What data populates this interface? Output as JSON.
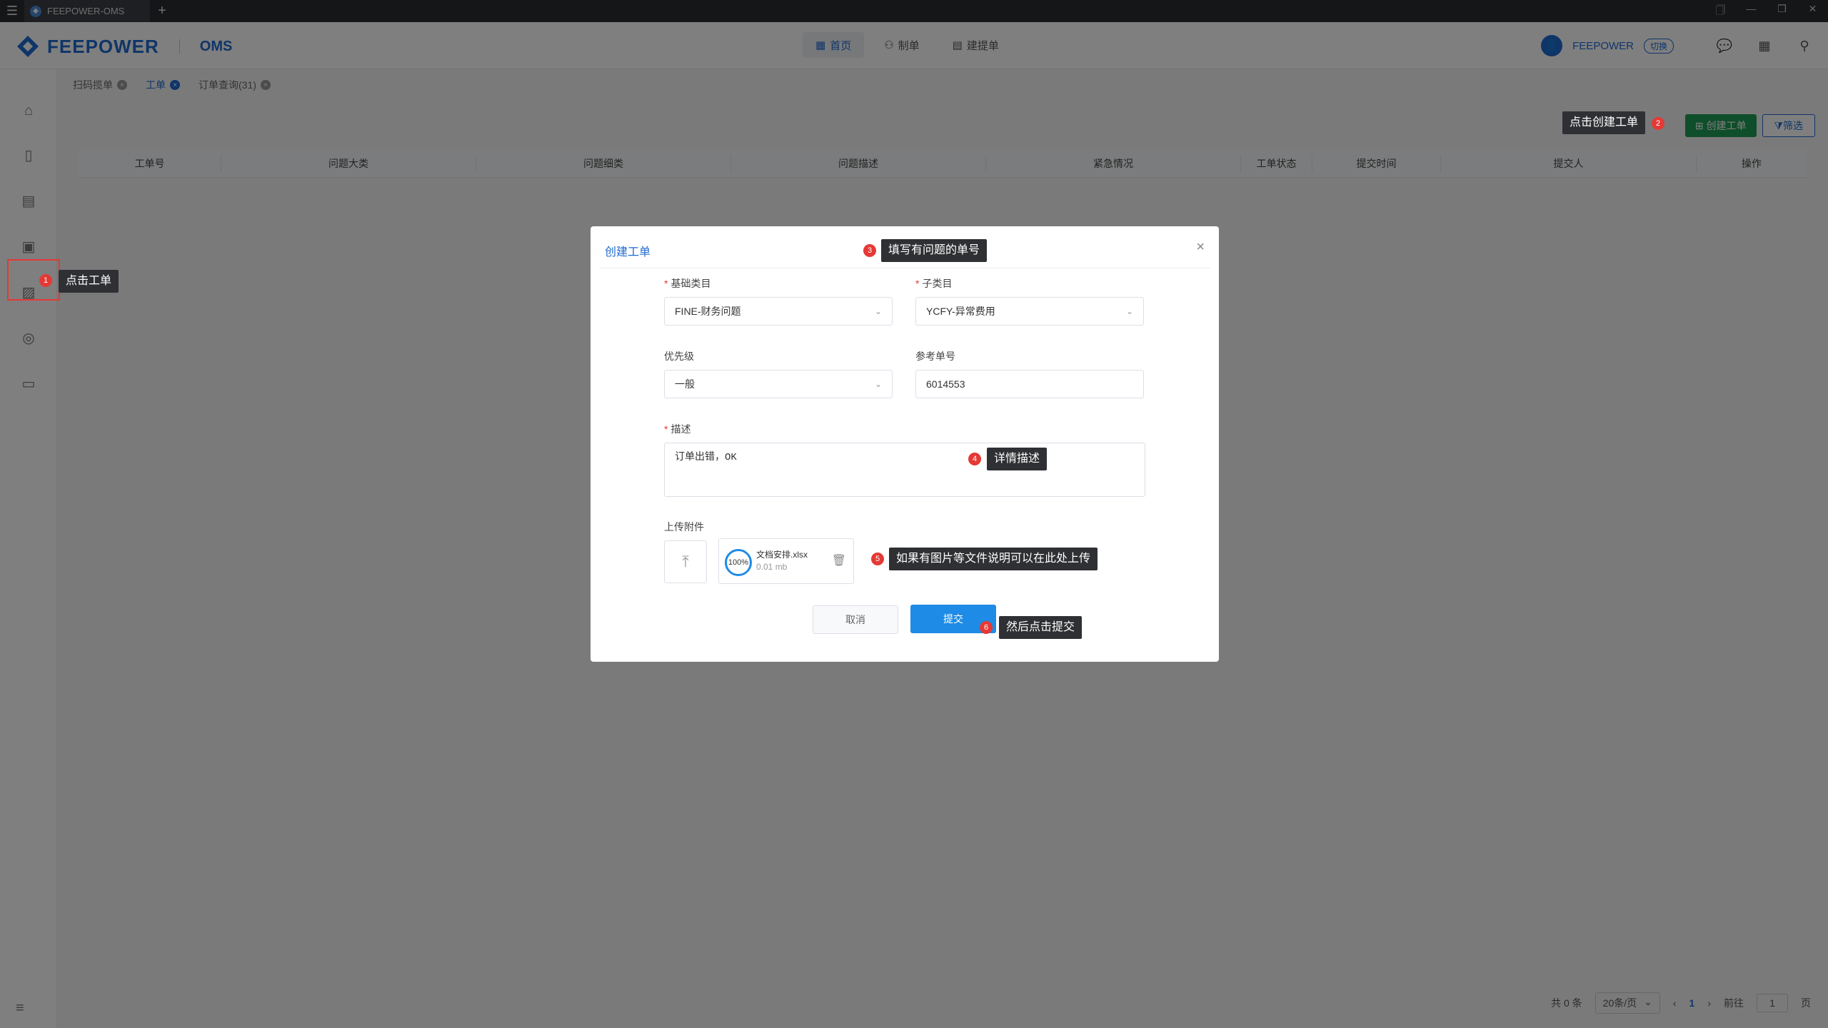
{
  "window": {
    "tab_title": "FEEPOWER-OMS",
    "add_tab": "+",
    "controls": [
      "🗍",
      "—",
      "❐",
      "✕"
    ]
  },
  "header": {
    "brand": "FEEPOWER",
    "product": "OMS",
    "nav": [
      {
        "label": "首页",
        "icon": "grid-icon"
      },
      {
        "label": "制单",
        "icon": "user-doc-icon"
      },
      {
        "label": "建提单",
        "icon": "doc-icon"
      }
    ],
    "user_name": "FEEPOWER",
    "switch_label": "切换"
  },
  "tabs": [
    {
      "label": "扫码揽单",
      "active": false
    },
    {
      "label": "工单",
      "active": true
    },
    {
      "label": "订单查询(31)",
      "active": false
    }
  ],
  "toolbar": {
    "create_label": "创建工单",
    "filter_label": "筛选"
  },
  "table": {
    "columns": [
      "工单号",
      "问题大类",
      "问题细类",
      "问题描述",
      "紧急情况",
      "工单状态",
      "提交时间",
      "提交人",
      "操作"
    ]
  },
  "pagination": {
    "total": "共 0 条",
    "page_size": "20条/页",
    "prev": "‹",
    "current_page": "1",
    "next": "›",
    "goto_label": "前往",
    "goto_value": "1",
    "page_suffix": "页"
  },
  "modal": {
    "title": "创建工单",
    "close": "×",
    "category_label": "基础类目",
    "category_value": "FINE-财务问题",
    "subcategory_label": "子类目",
    "subcategory_value": "YCFY-异常费用",
    "priority_label": "优先级",
    "priority_value": "一般",
    "ref_label": "参考单号",
    "ref_value": "6014553",
    "desc_label": "描述",
    "desc_value": "订单出错，OK",
    "upload_label": "上传附件",
    "file": {
      "name": "文档安排.xlsx",
      "size": "0.01 mb",
      "progress": "100%"
    },
    "cancel_label": "取消",
    "submit_label": "提交"
  },
  "annotations": [
    {
      "num": "1",
      "text": "点击工单"
    },
    {
      "num": "2",
      "text": "点击创建工单"
    },
    {
      "num": "3",
      "text": "填写有问题的单号"
    },
    {
      "num": "4",
      "text": "详情描述"
    },
    {
      "num": "5",
      "text": "如果有图片等文件说明可以在此处上传"
    },
    {
      "num": "6",
      "text": "然后点击提交"
    }
  ],
  "colors": {
    "brand_blue": "#1e6ad1",
    "create_green": "#1f9d55",
    "submit_blue": "#1e8be6",
    "annotation_red": "#e53935"
  }
}
